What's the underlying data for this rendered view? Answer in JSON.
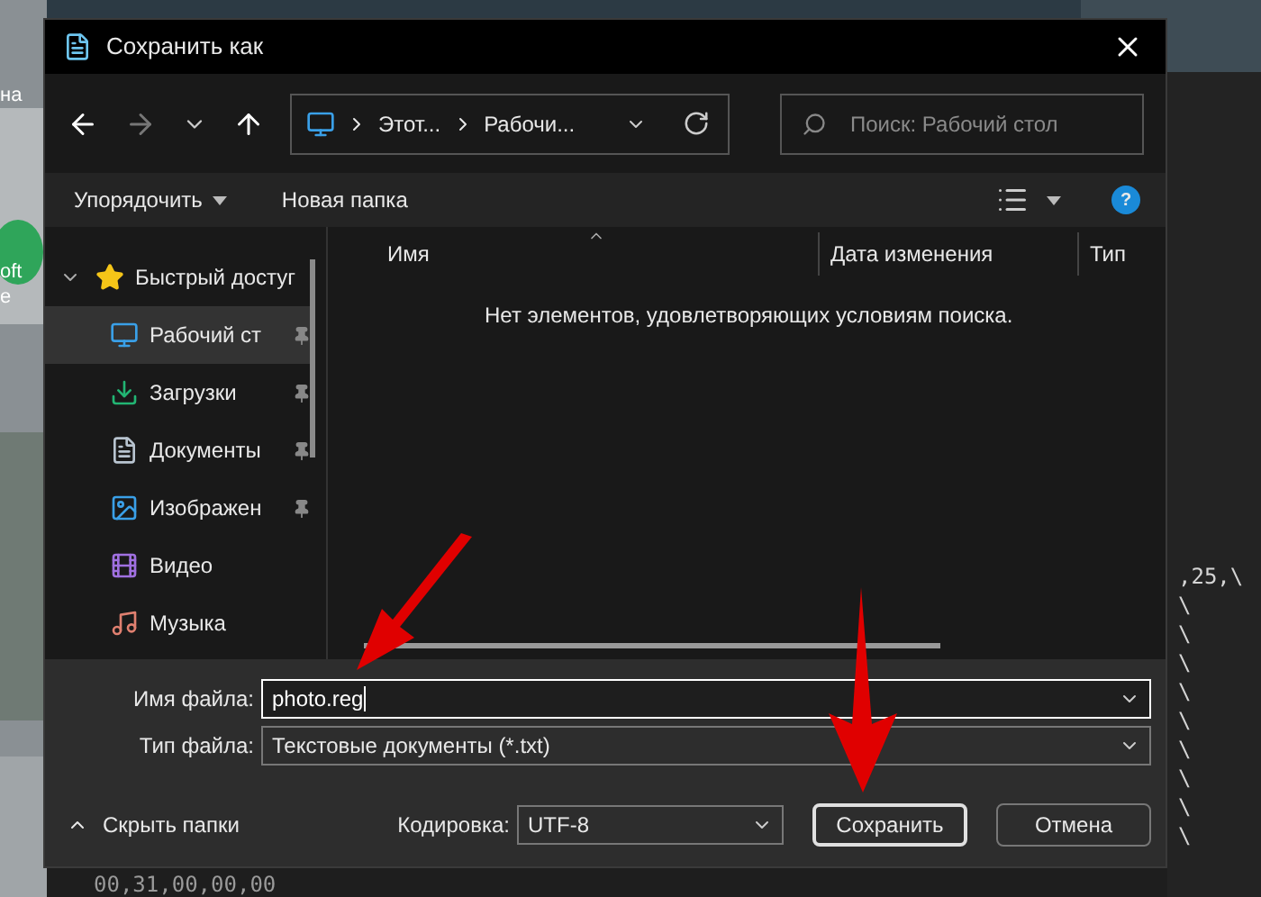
{
  "desktop": {
    "icon_labels": [
      "на",
      "oft",
      "e"
    ]
  },
  "editor": {
    "lines": [
      ",25,\\",
      "\\",
      "\\",
      "\\",
      "\\",
      "\\",
      "\\",
      "\\",
      "\\",
      "\\"
    ],
    "bottom_line": "00,31,00,00,00"
  },
  "window": {
    "title": "Сохранить как"
  },
  "address_bar": {
    "segments": [
      "Этот...",
      "Рабочи..."
    ]
  },
  "search": {
    "placeholder": "Поиск: Рабочий стол"
  },
  "toolbar": {
    "organize": "Упорядочить",
    "new_folder": "Новая папка",
    "help": "?"
  },
  "sidebar": {
    "items": [
      {
        "kind": "group",
        "label": "Быстрый достуг",
        "expanded": true,
        "selected": false,
        "pinned": false
      },
      {
        "kind": "item",
        "label": "Рабочий ст",
        "selected": true,
        "pinned": true
      },
      {
        "kind": "item",
        "label": "Загрузки",
        "selected": false,
        "pinned": true
      },
      {
        "kind": "item",
        "label": "Документы",
        "selected": false,
        "pinned": true
      },
      {
        "kind": "item",
        "label": "Изображен",
        "selected": false,
        "pinned": true
      },
      {
        "kind": "item",
        "label": "Видео",
        "selected": false,
        "pinned": false
      },
      {
        "kind": "item",
        "label": "Музыка",
        "selected": false,
        "pinned": false
      }
    ]
  },
  "file_list": {
    "columns": [
      "Имя",
      "Дата изменения",
      "Тип"
    ],
    "empty_message": "Нет элементов, удовлетворяющих условиям поиска."
  },
  "form": {
    "file_name_label": "Имя файла:",
    "file_name": "photo.reg",
    "file_type_label": "Тип файла:",
    "file_type": "Текстовые документы (*.txt)",
    "hide_folders": "Скрыть папки",
    "encoding_label": "Кодировка:",
    "encoding": "UTF-8"
  },
  "buttons": [
    {
      "label": "Сохранить",
      "default": true
    },
    {
      "label": "Отмена",
      "default": false
    }
  ]
}
